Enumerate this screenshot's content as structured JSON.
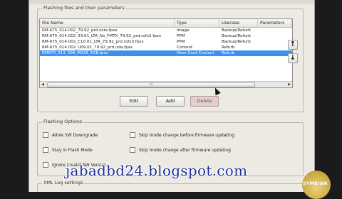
{
  "groups": {
    "files_title": "Flashing files and their parameters",
    "options_title": "Flashing Options",
    "xml_title": "XML Log settings"
  },
  "table": {
    "columns": [
      "File Name",
      "Type",
      "Usecase",
      "Parameters"
    ],
    "rows": [
      [
        "RM-675_014.002_79.92_prd.core.fpsx",
        "Image",
        "Backup/Refurb",
        ""
      ],
      [
        "RM-675_014.002_33.01_LTA_Nx_FMTX_79.92_prd.rofx2.fpsx",
        "PPM",
        "Backup/Refurb",
        ""
      ],
      [
        "RM-675_014.002_C10.01_LTA_79.92_prd.rofx3.fpsx",
        "PPM",
        "Backup/Refurb",
        ""
      ],
      [
        "RM-675_014.002_U09.01_79.92_prd.uda.fpsx",
        "Content",
        "Refurb",
        ""
      ],
      [
        "RM675_013_008_M028_3GB.fpsx",
        "Mem Card Content",
        "Refurb",
        ""
      ]
    ],
    "selected_index": 4,
    "scroll_grip": "III"
  },
  "buttons": {
    "edit": "Edit",
    "add": "Add",
    "delete": "Delete",
    "up_glyph": "↑",
    "down_glyph": "↓"
  },
  "options": {
    "allow_sw_downgrade": "Allow SW Downgrade",
    "stay_in_flash_mode": "Stay in Flash Mode",
    "ignore_invalid_sw_version": "Ignore Invalid SW Version",
    "skip_mode_change_before": "Skip mode change before firmware updating",
    "skip_mode_change_after": "Skip mode change after firmware updating"
  },
  "watermark": "jabadbd24.blogspot.com",
  "logo_text": "SYMBIAN",
  "colors": {
    "selection": "#3b8ff0",
    "window_bg": "#eceae3",
    "watermark": "#1b2f9a"
  }
}
